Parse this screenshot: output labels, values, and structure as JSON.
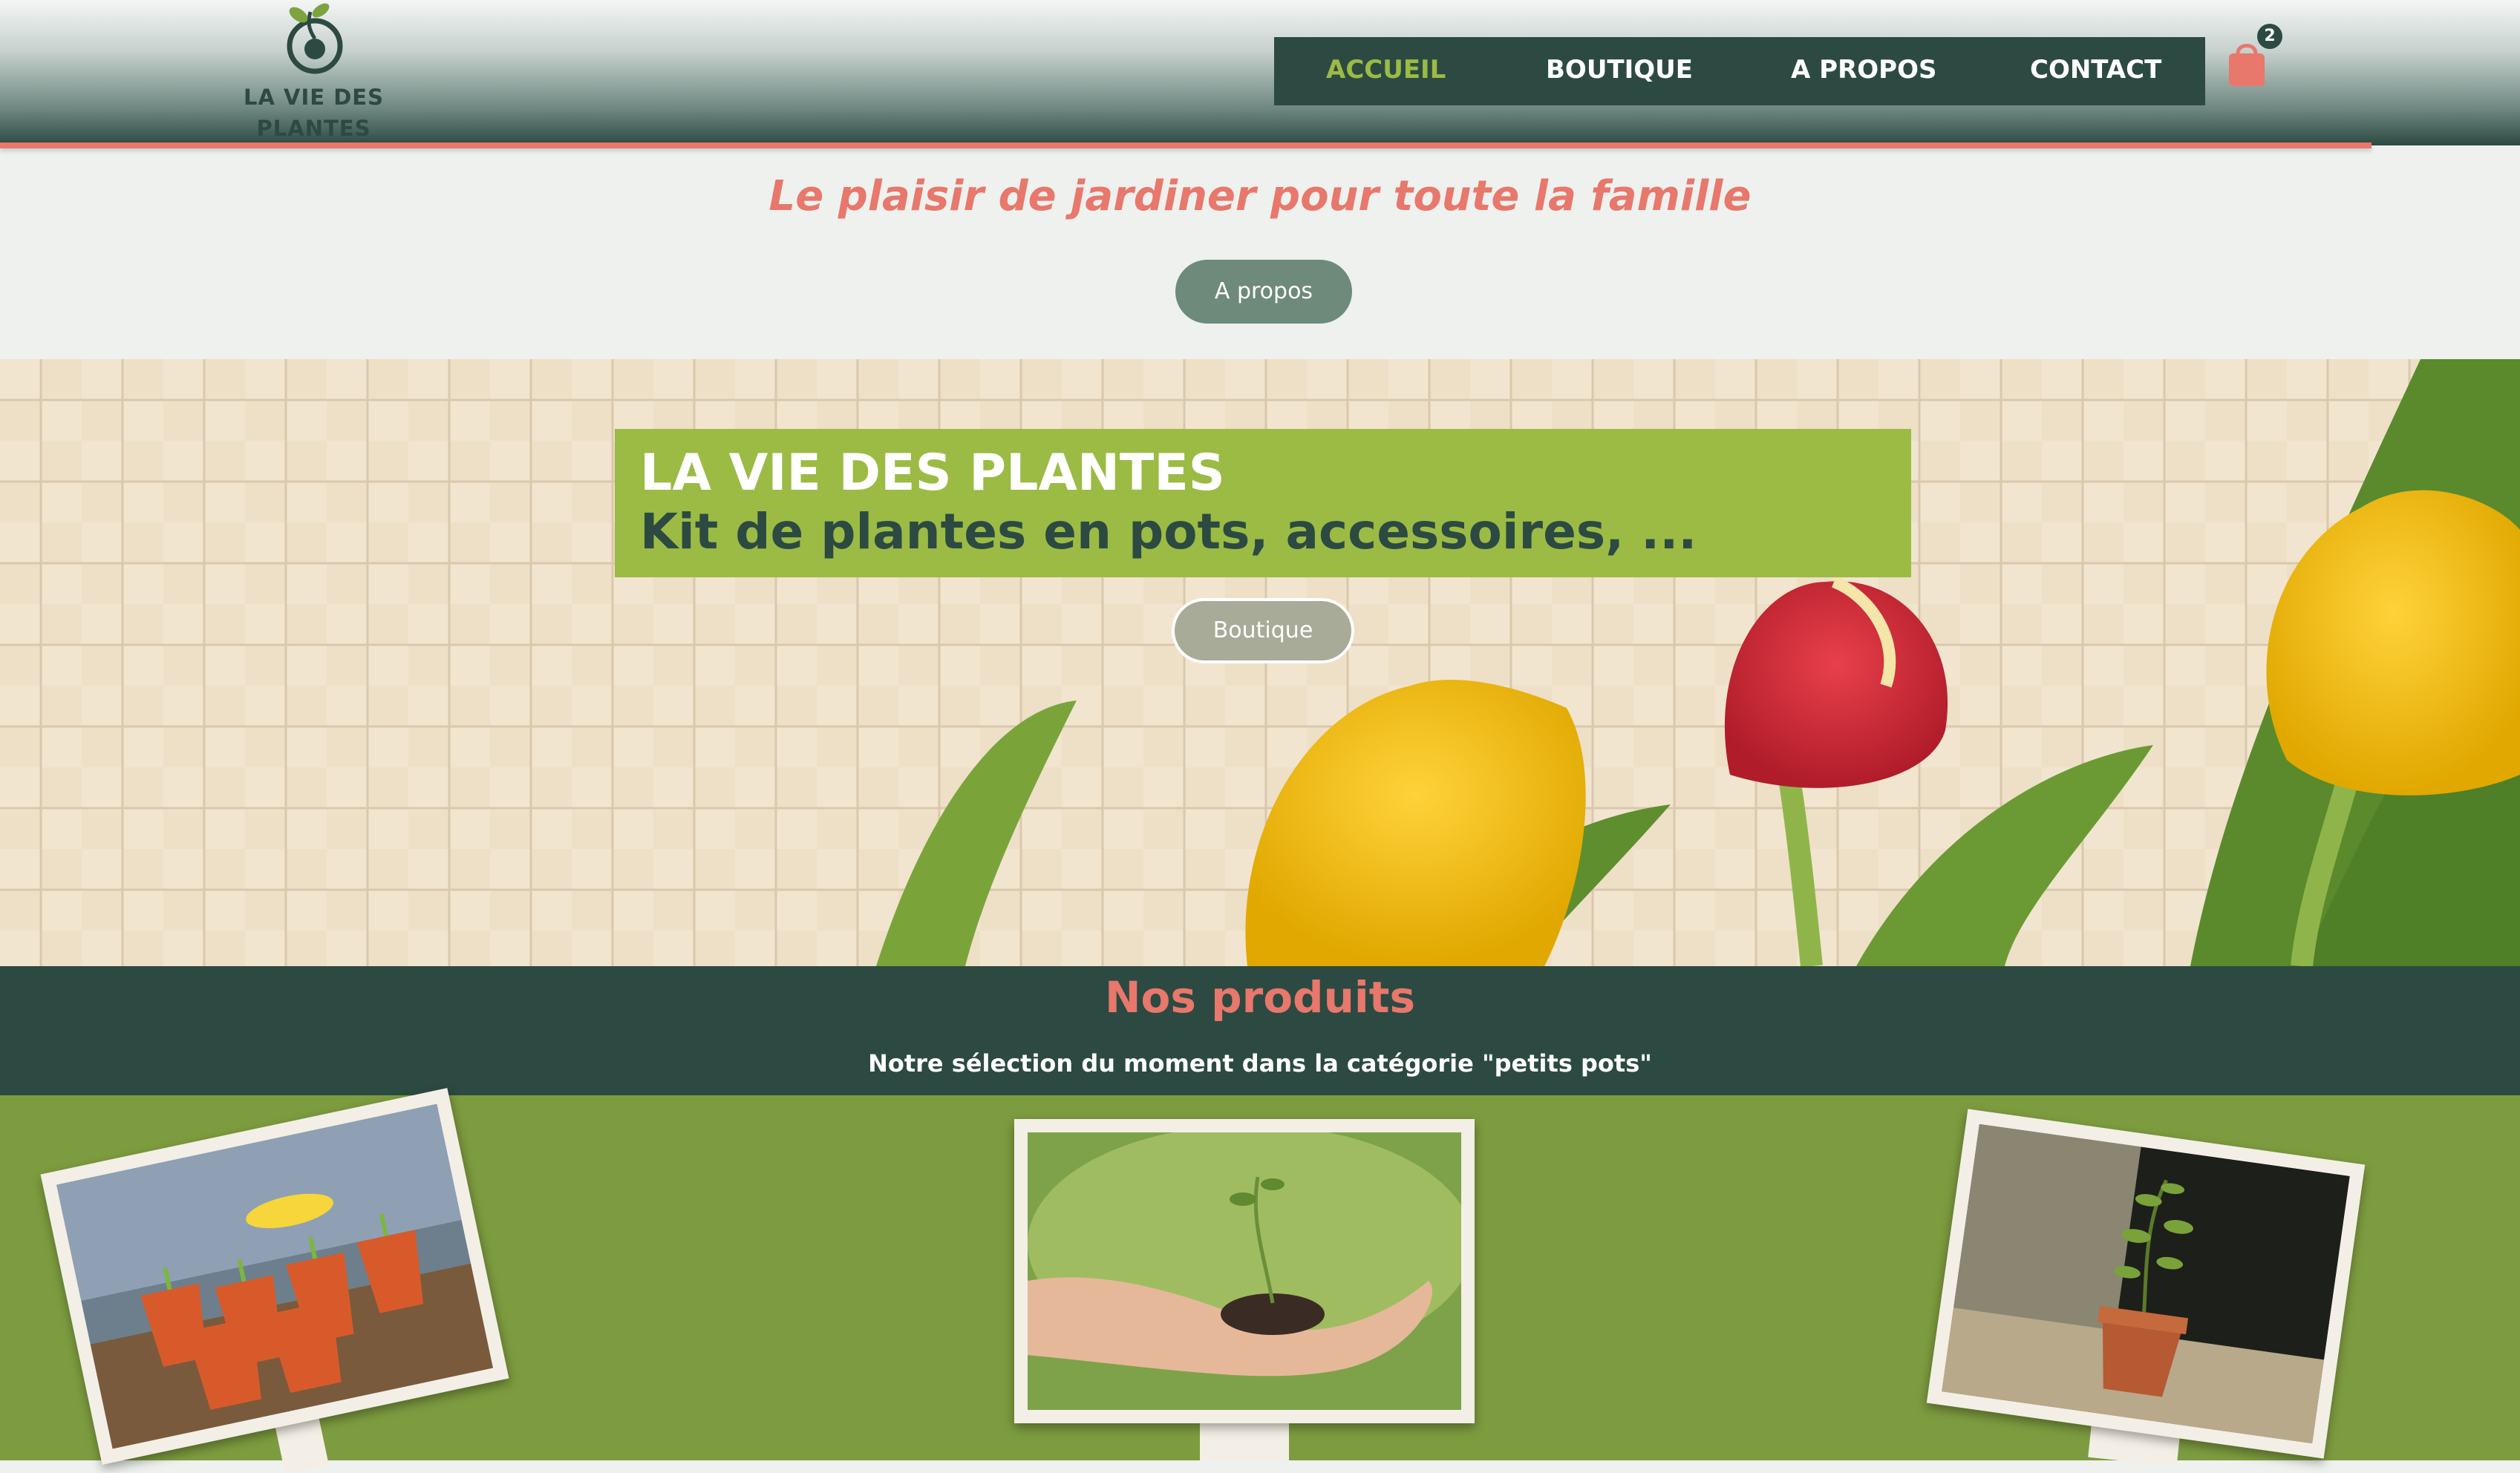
{
  "brand": {
    "name_line1": "LA VIE DES",
    "name_line2": "PLANTES"
  },
  "nav": {
    "items": [
      {
        "label": "ACCUEIL",
        "active": true
      },
      {
        "label": "BOUTIQUE",
        "active": false
      },
      {
        "label": "A PROPOS",
        "active": false
      },
      {
        "label": "CONTACT",
        "active": false
      }
    ]
  },
  "cart": {
    "icon": "shopping-bag-icon",
    "count": "2"
  },
  "tagline": "Le plaisir de jardiner pour toute la famille",
  "about_button": "A propos",
  "hero": {
    "title": "LA VIE DES PLANTES",
    "subtitle": "Kit de plantes en pots, accessoires, ...",
    "button": "Boutique"
  },
  "products": {
    "title": "Nos produits",
    "subtitle": "Notre sélection du moment dans la catégorie \"petits pots\""
  },
  "colors": {
    "dark_green": "#2c4a42",
    "accent_green": "#9bbb45",
    "coral": "#e8776c",
    "product_bg": "#7d9c3f"
  }
}
